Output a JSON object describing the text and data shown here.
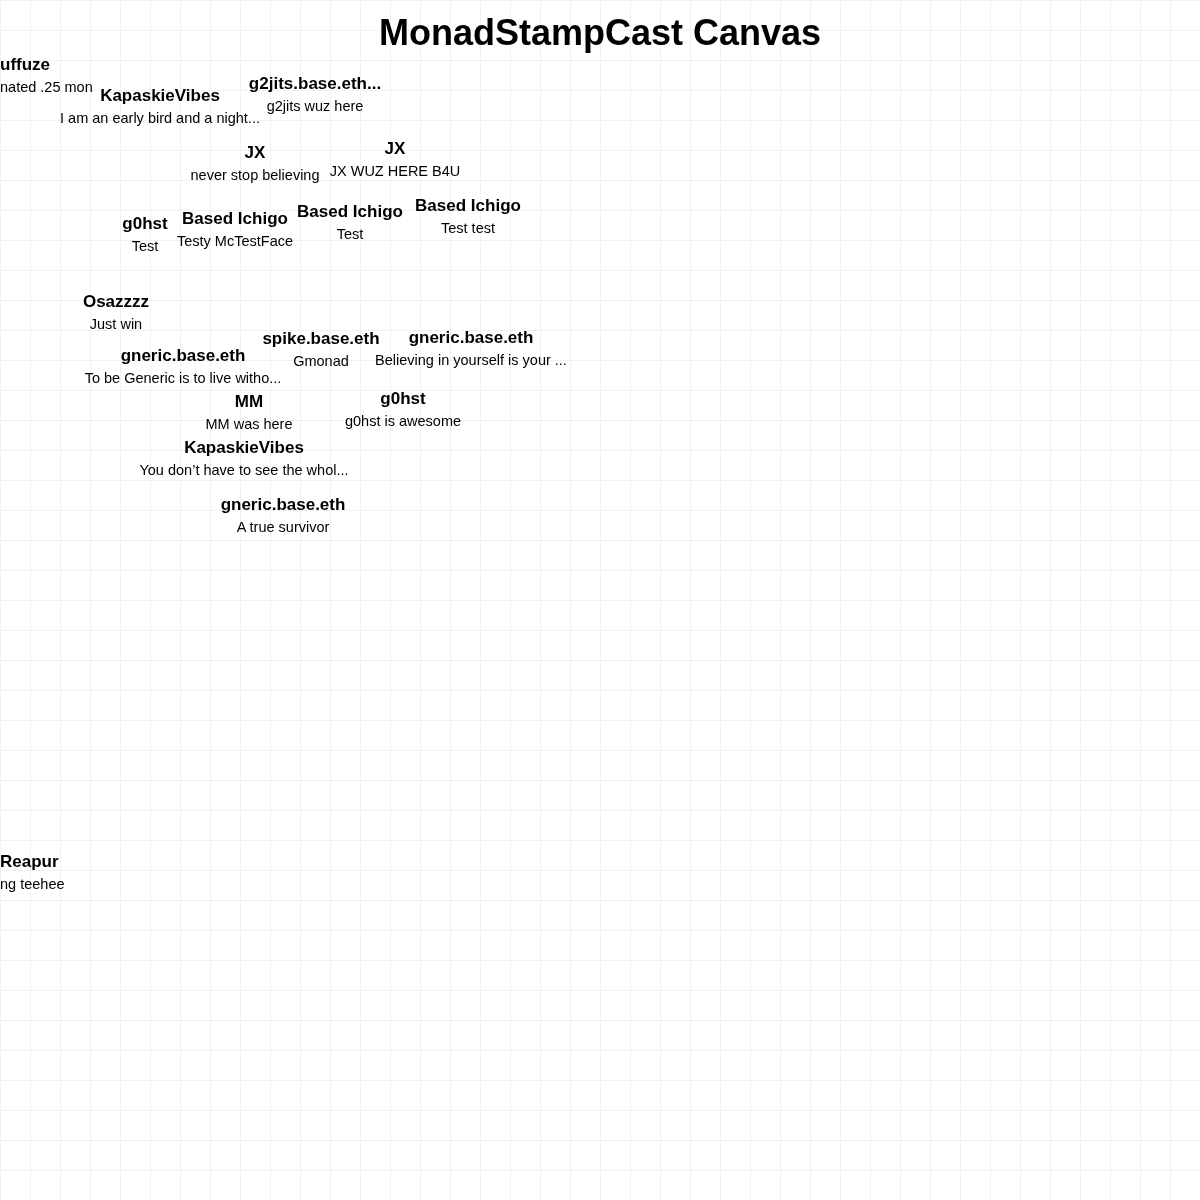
{
  "title": "MonadStampCast Canvas",
  "stamps": [
    {
      "name": "uffuze",
      "message": "nated .25 mon"
    },
    {
      "name": "KapaskieVibes",
      "message": "I am an early bird and a night..."
    },
    {
      "name": "g2jits.base.eth...",
      "message": "g2jits wuz here"
    },
    {
      "name": "JX",
      "message": "never stop believing"
    },
    {
      "name": "JX",
      "message": "JX WUZ HERE B4U"
    },
    {
      "name": "g0hst",
      "message": "Test"
    },
    {
      "name": "Based Ichigo",
      "message": "Testy McTestFace"
    },
    {
      "name": "Based Ichigo",
      "message": "Test"
    },
    {
      "name": "Based Ichigo",
      "message": "Test test"
    },
    {
      "name": "Osazzzz",
      "message": "Just win"
    },
    {
      "name": "gneric.base.eth",
      "message": "To be Generic is to live witho..."
    },
    {
      "name": "spike.base.eth",
      "message": "Gmonad"
    },
    {
      "name": "gneric.base.eth",
      "message": "Believing in yourself is your ..."
    },
    {
      "name": "MM",
      "message": "MM was here"
    },
    {
      "name": "g0hst",
      "message": "g0hst is awesome"
    },
    {
      "name": "KapaskieVibes",
      "message": "You don’t have to see the whol..."
    },
    {
      "name": "gneric.base.eth",
      "message": "A true survivor"
    },
    {
      "name": "Reapur",
      "message": "ng teehee"
    }
  ]
}
